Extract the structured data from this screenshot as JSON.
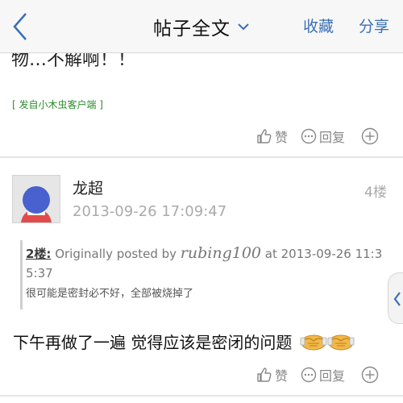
{
  "topbar": {
    "title": "帖子全文",
    "favorite": "收藏",
    "share": "分享"
  },
  "previous_post": {
    "text_tail": "物…不解啊！！",
    "client_link": "[ 发自小木虫客户端 ]",
    "like": "赞",
    "reply": "回复"
  },
  "post": {
    "username": "龙超",
    "time": "2013-09-26 17:09:47",
    "floor": "4楼",
    "quote": {
      "floor_ref": "2楼:",
      "prefix": " Originally posted by ",
      "user": "rubing100",
      "suffix": " at 2013-09-26 11:35:37",
      "body": "很可能是密封必不好，全部被烧掉了"
    },
    "content": "下午再做了一遍  觉得应该是密闭的问题",
    "emoticons": [
      "handshake-emoticon",
      "handshake-emoticon"
    ],
    "like": "赞",
    "reply": "回复"
  },
  "colors": {
    "accent": "#3a6fb5",
    "client_green": "#2e8b2e",
    "meta_gray": "#aaaaaa"
  }
}
